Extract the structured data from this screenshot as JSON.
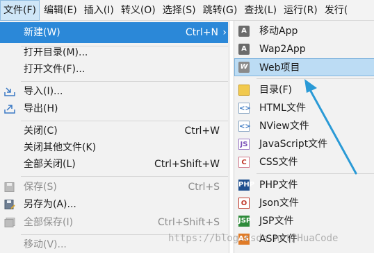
{
  "menubar": {
    "items": [
      "文件(F)",
      "编辑(E)",
      "插入(I)",
      "转义(O)",
      "选择(S)",
      "跳转(G)",
      "查找(L)",
      "运行(R)",
      "发行("
    ]
  },
  "file_menu": {
    "new": {
      "label": "新建(W)",
      "shortcut": "Ctrl+N",
      "arrow": "›"
    },
    "open_dir": {
      "label": "打开目录(M)..."
    },
    "open_file": {
      "label": "打开文件(F)..."
    },
    "import": {
      "label": "导入(I)..."
    },
    "export": {
      "label": "导出(H)"
    },
    "close": {
      "label": "关闭(C)",
      "shortcut": "Ctrl+W"
    },
    "close_others": {
      "label": "关闭其他文件(K)"
    },
    "close_all": {
      "label": "全部关闭(L)",
      "shortcut": "Ctrl+Shift+W"
    },
    "save": {
      "label": "保存(S)",
      "shortcut": "Ctrl+S"
    },
    "save_as": {
      "label": "另存为(A)..."
    },
    "save_all": {
      "label": "全部保存(I)",
      "shortcut": "Ctrl+Shift+S"
    },
    "move": {
      "label": "移动(V)..."
    }
  },
  "new_submenu": {
    "items": [
      {
        "label": "移动App",
        "icon": "A"
      },
      {
        "label": "Wap2App",
        "icon": "A"
      },
      {
        "label": "Web项目",
        "icon": "W"
      },
      {
        "label": "目录(F)",
        "icon": ""
      },
      {
        "label": "HTML文件",
        "icon": "<>"
      },
      {
        "label": "NView文件",
        "icon": "<>"
      },
      {
        "label": "JavaScript文件",
        "icon": "JS"
      },
      {
        "label": "CSS文件",
        "icon": "C"
      },
      {
        "label": "PHP文件",
        "icon": "PHP"
      },
      {
        "label": "Json文件",
        "icon": "O"
      },
      {
        "label": "JSP文件",
        "icon": "JSP"
      },
      {
        "label": "ASP文件",
        "icon": "ASP"
      }
    ]
  },
  "watermark": "https://blog.csdn.net/HuaCode",
  "colors": {
    "highlight": "#2b88d8",
    "submenu_highlight": "#bcdcf4",
    "arrow": "#2a9ad6"
  }
}
